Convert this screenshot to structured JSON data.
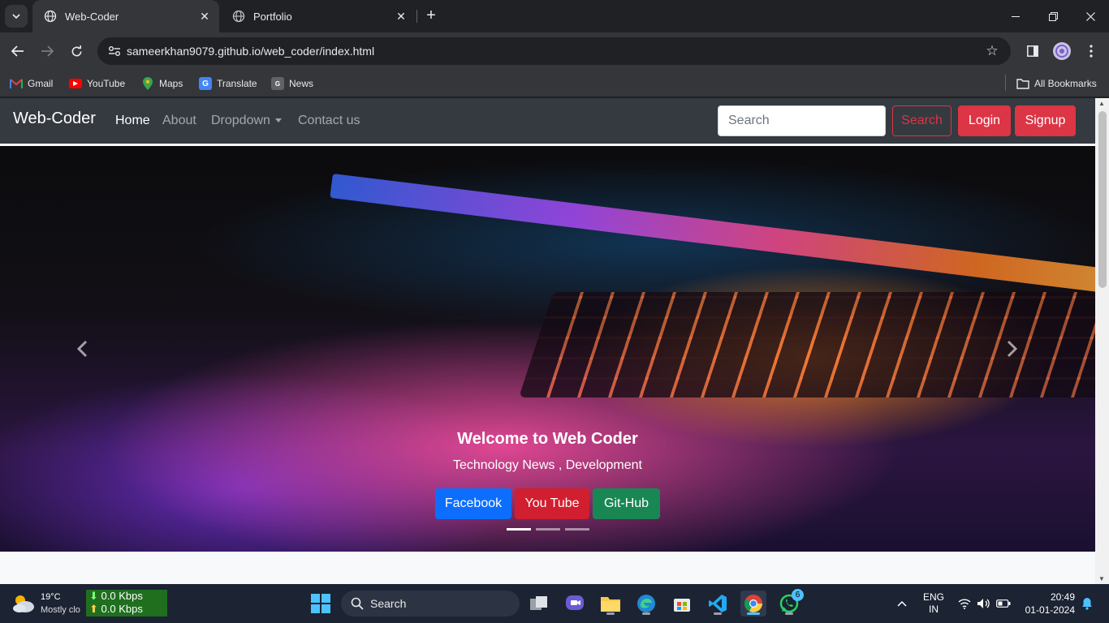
{
  "browser": {
    "tabs": [
      {
        "title": "Web-Coder",
        "active": true
      },
      {
        "title": "Portfolio",
        "active": false
      }
    ],
    "url": "sameerkhan9079.github.io/web_coder/index.html",
    "bookmarks": [
      {
        "label": "Gmail",
        "icon": "gmail-icon"
      },
      {
        "label": "YouTube",
        "icon": "youtube-icon"
      },
      {
        "label": "Maps",
        "icon": "maps-icon"
      },
      {
        "label": "Translate",
        "icon": "translate-icon"
      },
      {
        "label": "News",
        "icon": "news-icon"
      }
    ],
    "all_bookmarks": "All Bookmarks"
  },
  "site": {
    "brand": "Web-Coder",
    "nav": {
      "home": "Home",
      "about": "About",
      "dropdown": "Dropdown",
      "contact": "Contact us"
    },
    "search_placeholder": "Search",
    "search_button": "Search",
    "login": "Login",
    "signup": "Signup",
    "carousel": {
      "title": "Welcome to Web Coder",
      "subtitle": "Technology News , Development",
      "buttons": {
        "facebook": "Facebook",
        "youtube": "You Tube",
        "github": "Git-Hub"
      },
      "slides": 3,
      "active_slide": 1
    }
  },
  "colors": {
    "navbar": "#343a40",
    "danger": "#dc3545",
    "facebook": "#0d6efd",
    "youtube": "#d21f2f",
    "github": "#198754"
  },
  "taskbar": {
    "weather_temp": "19°C",
    "weather_desc": "Mostly clo",
    "down_speed": "0.0 Kbps",
    "up_speed": "0.0 Kbps",
    "search_label": "Search",
    "lang": "ENG",
    "region": "IN",
    "time": "20:49",
    "date": "01-01-2024",
    "whatsapp_badge": "6"
  }
}
